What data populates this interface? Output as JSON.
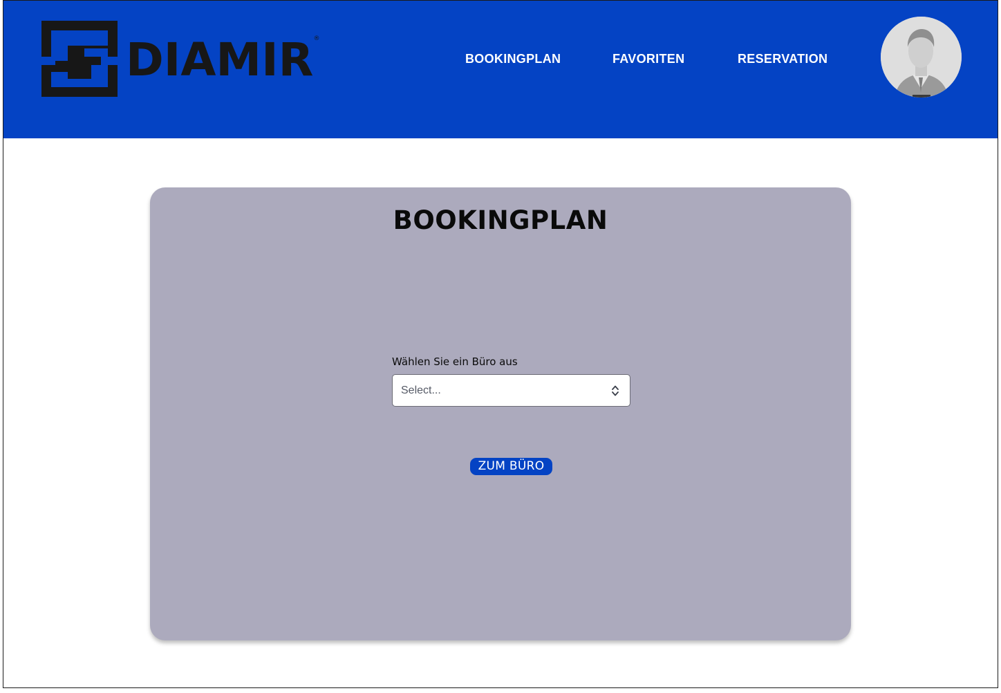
{
  "header": {
    "brand": {
      "logo_text": "DIAMIR",
      "registered_mark": "®",
      "logo_icon": "diamir-logo-mark"
    },
    "nav": [
      {
        "label": "BOOKINGPLAN"
      },
      {
        "label": "FAVORITEN"
      },
      {
        "label": "RESERVATION"
      }
    ],
    "avatar_icon": "user-avatar",
    "background_color": "#0443c4"
  },
  "main": {
    "title": "BOOKINGPLAN",
    "office_select": {
      "label": "Wählen Sie ein Büro aus",
      "placeholder": "Select...",
      "icon": "chevron-up-down-icon"
    },
    "submit_label": "ZUM BÜRO",
    "card_color": "#acaabd",
    "button_color": "#0443c4"
  }
}
